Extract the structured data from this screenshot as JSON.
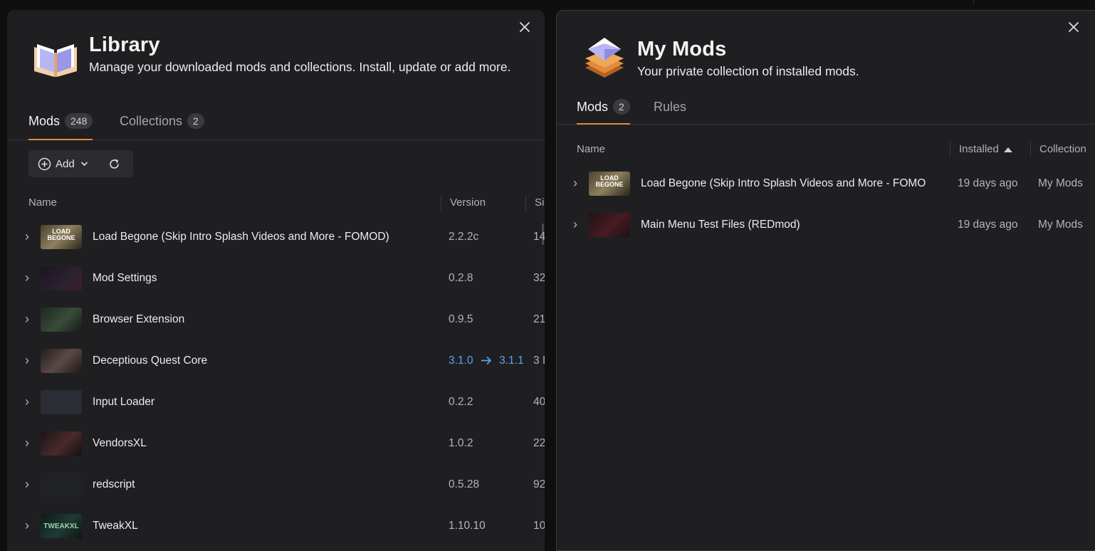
{
  "library": {
    "title": "Library",
    "subtitle": "Manage your downloaded mods and collections. Install, update or add more.",
    "tabs": [
      {
        "label": "Mods",
        "count": "248"
      },
      {
        "label": "Collections",
        "count": "2"
      }
    ],
    "toolbar": {
      "add_label": "Add"
    },
    "columns": {
      "name": "Name",
      "version": "Version",
      "size": "Si"
    },
    "rows": [
      {
        "name": "Load Begone (Skip Intro Splash Videos and More - FOMOD)",
        "version": "2.2.2c",
        "size": "14"
      },
      {
        "name": "Mod Settings",
        "version": "0.2.8",
        "size": "32"
      },
      {
        "name": "Browser Extension",
        "version": "0.9.5",
        "size": "21"
      },
      {
        "name": "Deceptious Quest Core",
        "version_from": "3.1.0",
        "version_to": "3.1.1",
        "size": "3 I"
      },
      {
        "name": "Input Loader",
        "version": "0.2.2",
        "size": "40"
      },
      {
        "name": "VendorsXL",
        "version": "1.0.2",
        "size": "22"
      },
      {
        "name": "redscript",
        "version": "0.5.28",
        "size": "92"
      },
      {
        "name": "TweakXL",
        "version": "1.10.10",
        "size": "10"
      }
    ]
  },
  "mymods": {
    "title": "My Mods",
    "subtitle": "Your private collection of installed mods.",
    "tabs": [
      {
        "label": "Mods",
        "count": "2"
      },
      {
        "label": "Rules"
      }
    ],
    "columns": {
      "name": "Name",
      "installed": "Installed",
      "collection": "Collection"
    },
    "rows": [
      {
        "name": "Load Begone (Skip Intro Splash Videos and More - FOMO",
        "installed": "19 days ago",
        "collection": "My Mods"
      },
      {
        "name": "Main Menu Test Files (REDmod)",
        "installed": "19 days ago",
        "collection": "My Mods"
      }
    ]
  },
  "colors": {
    "accent": "#e48a3b",
    "update": "#5aa2f0",
    "panel": "#1f1f22"
  },
  "icons": [
    "close-icon",
    "book-icon",
    "layers-icon",
    "plus-circle-icon",
    "chevron-down-icon",
    "refresh-icon",
    "chevron-right-icon",
    "sort-ascending-icon"
  ]
}
